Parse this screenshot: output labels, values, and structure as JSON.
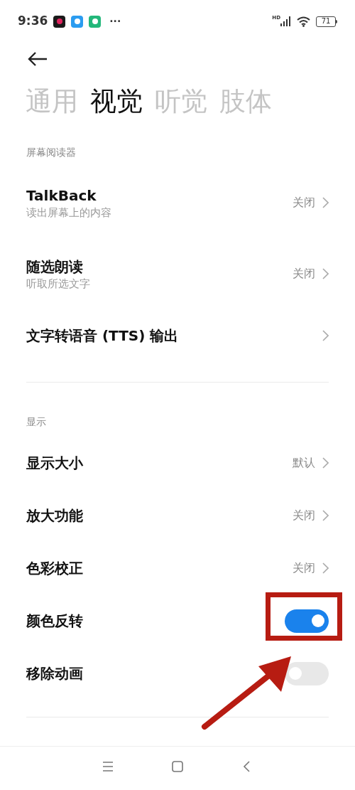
{
  "status_bar": {
    "time": "9:36",
    "more": "···",
    "network": "HD",
    "battery": "71"
  },
  "tabs": [
    {
      "label": "通用",
      "selected": false
    },
    {
      "label": "视觉",
      "selected": true
    },
    {
      "label": "听觉",
      "selected": false
    },
    {
      "label": "肢体",
      "selected": false
    }
  ],
  "sections": [
    {
      "title": "屏幕阅读器",
      "items": [
        {
          "kind": "nav",
          "title": "TalkBack",
          "subtitle": "读出屏幕上的内容",
          "value": "关闭"
        },
        {
          "kind": "nav",
          "title": "随选朗读",
          "subtitle": "听取所选文字",
          "value": "关闭"
        },
        {
          "kind": "nav",
          "title": "文字转语音 (TTS) 输出"
        }
      ]
    },
    {
      "title": "显示",
      "items": [
        {
          "kind": "nav",
          "title": "显示大小",
          "value": "默认"
        },
        {
          "kind": "nav",
          "title": "放大功能",
          "value": "关闭"
        },
        {
          "kind": "nav",
          "title": "色彩校正",
          "value": "关闭"
        },
        {
          "kind": "toggle",
          "title": "颜色反转",
          "on": true
        },
        {
          "kind": "toggle",
          "title": "移除动画",
          "on": false
        }
      ]
    }
  ]
}
